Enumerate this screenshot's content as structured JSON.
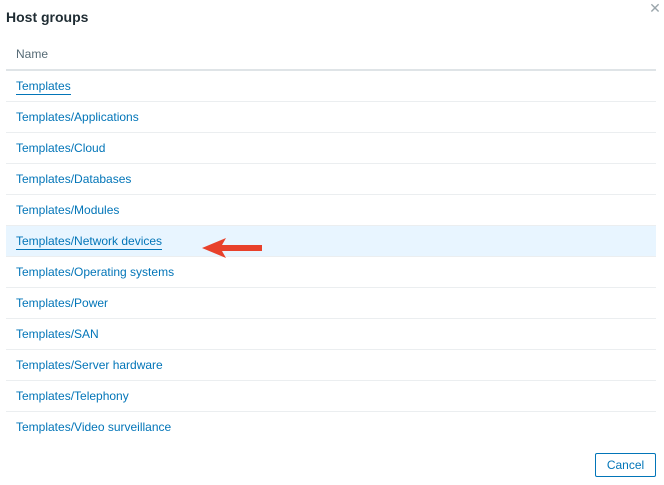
{
  "dialog": {
    "title": "Host groups",
    "close_glyph": "✕",
    "cancel_label": "Cancel"
  },
  "table": {
    "column_header": "Name",
    "rows": [
      {
        "name": "Templates"
      },
      {
        "name": "Templates/Applications"
      },
      {
        "name": "Templates/Cloud"
      },
      {
        "name": "Templates/Databases"
      },
      {
        "name": "Templates/Modules"
      },
      {
        "name": "Templates/Network devices"
      },
      {
        "name": "Templates/Operating systems"
      },
      {
        "name": "Templates/Power"
      },
      {
        "name": "Templates/SAN"
      },
      {
        "name": "Templates/Server hardware"
      },
      {
        "name": "Templates/Telephony"
      },
      {
        "name": "Templates/Video surveillance"
      }
    ],
    "highlighted_row": 5
  },
  "icons": {
    "close": "close-icon",
    "annotation": "red-arrow-icon"
  },
  "colors": {
    "link": "#0275b8",
    "highlight": "#e8f5ff",
    "arrow": "#e8412b"
  }
}
